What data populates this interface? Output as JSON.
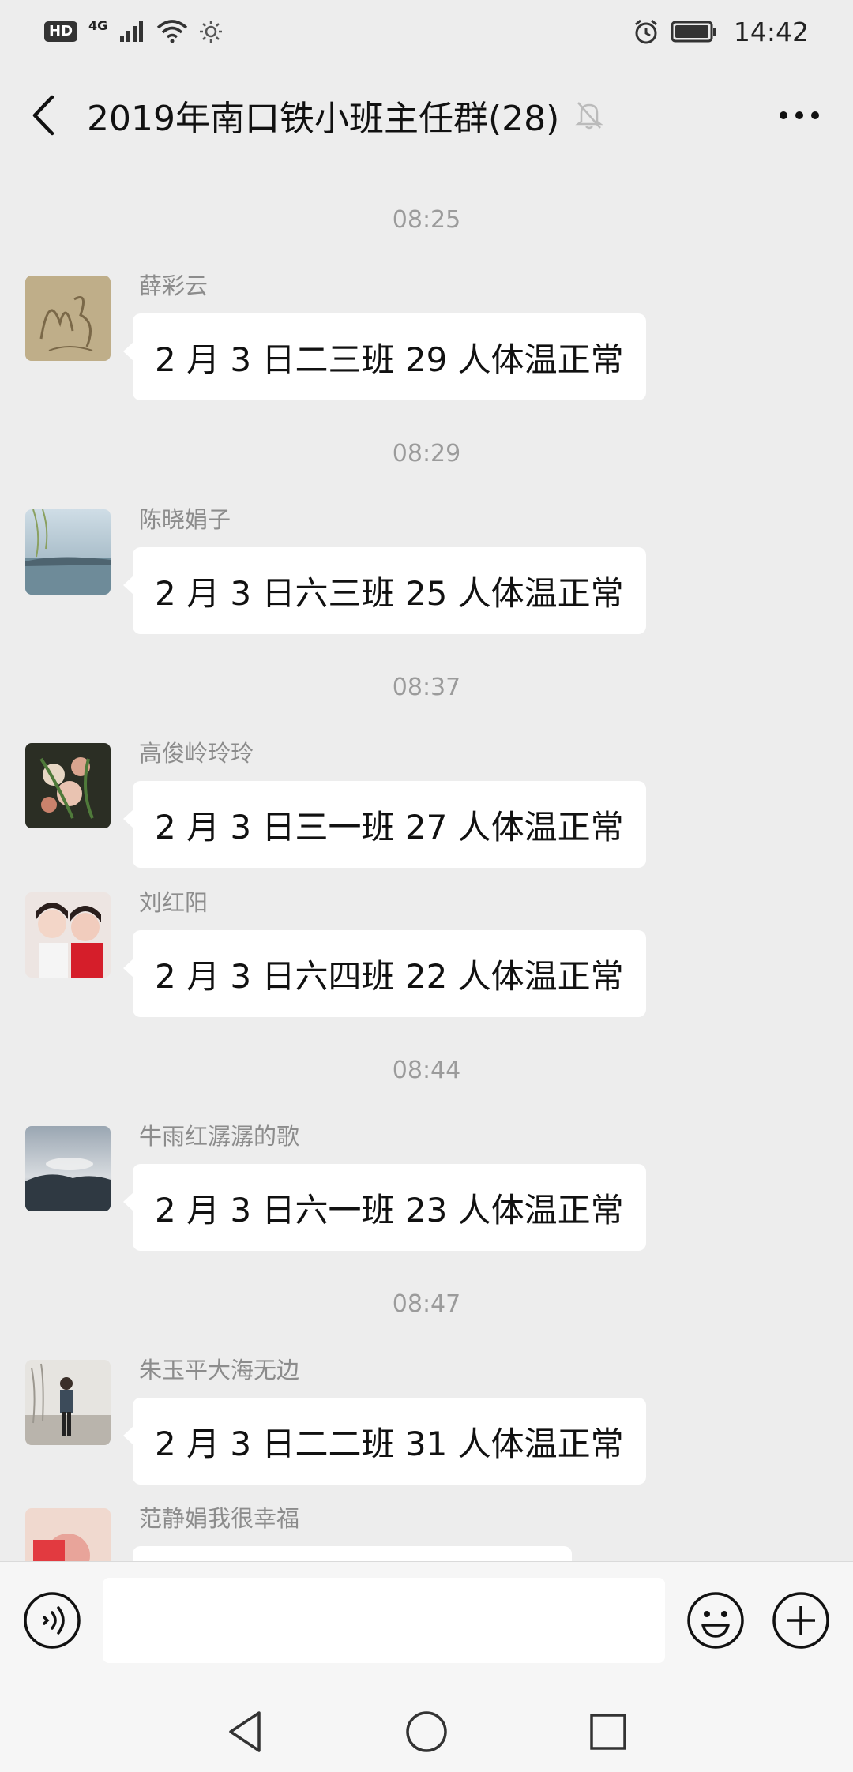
{
  "status_bar": {
    "hd": "HD",
    "network": "4G",
    "time": "14:42"
  },
  "header": {
    "title": "2019年南口铁小班主任群(28)"
  },
  "timestamps": [
    "08:25",
    "08:29",
    "08:37",
    "08:44",
    "08:47"
  ],
  "messages": [
    {
      "sender": "薛彩云",
      "text": "2 月 3 日二三班 29 人体温正常"
    },
    {
      "sender": "陈晓娟子",
      "text": "2 月 3 日六三班 25 人体温正常"
    },
    {
      "sender": "高俊岭玲玲",
      "text": "2 月 3 日三一班 27 人体温正常"
    },
    {
      "sender": "刘红阳",
      "text": "2 月 3 日六四班 22 人体温正常"
    },
    {
      "sender": "牛雨红潺潺的歌",
      "text": "2 月 3 日六一班 23 人体温正常"
    },
    {
      "sender": "朱玉平大海无边",
      "text": "2 月 3 日二二班 31 人体温正常"
    },
    {
      "sender": "范静娟我很幸福",
      "text": ""
    }
  ],
  "input": {
    "value": ""
  },
  "colors": {
    "background": "#EDEDED",
    "bubble": "#FFFFFF",
    "meta_text": "#9B9B9B"
  }
}
